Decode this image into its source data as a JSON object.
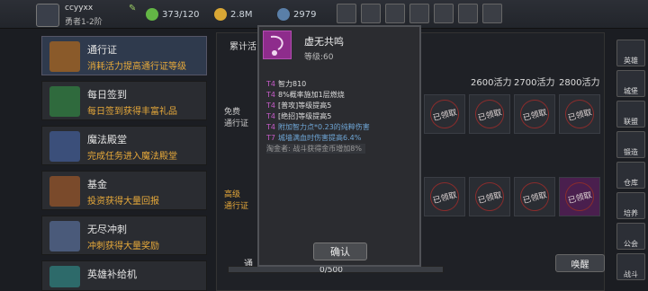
{
  "player": {
    "name": "ccyyxx",
    "rank": "勇者1-2阶"
  },
  "resources": {
    "energy": "373/120",
    "gold": "2.8M",
    "gems": "2979"
  },
  "left_menu": [
    {
      "title": "通行证",
      "subtitle": "消耗活力提高通行证等级"
    },
    {
      "title": "每日签到",
      "subtitle": "每日签到获得丰富礼品"
    },
    {
      "title": "魔法殿堂",
      "subtitle": "完成任务进入魔法殿堂"
    },
    {
      "title": "基金",
      "subtitle": "投资获得大量回报"
    },
    {
      "title": "无尽冲刺",
      "subtitle": "冲刺获得大量奖励"
    },
    {
      "title": "英雄补给机",
      "subtitle": ""
    }
  ],
  "main": {
    "tab_label": "累计活",
    "free_label": "免费\n通行证",
    "premium_label": "高级\n通行证",
    "column_headers": [
      "2600活力",
      "2700活力",
      "2800活力"
    ],
    "claimed_label": "已领取",
    "progress_text": "0/500",
    "progress_fraction": 0,
    "wake_button": "唤醒",
    "bottom_left": "通"
  },
  "popup": {
    "title": "虚无共鸣",
    "level": "等级:60",
    "stats": [
      {
        "tier": "T4",
        "text": "智力810"
      },
      {
        "tier": "T4",
        "text": "8%概率施加1层燃烧"
      },
      {
        "tier": "T4",
        "text": "[普攻]等级提高5"
      },
      {
        "tier": "T4",
        "text": "[绝招]等级提高5"
      },
      {
        "tier": "T4",
        "text": "附加智力点*0.23的纯粹伤害"
      },
      {
        "tier": "T7",
        "text": "城墙满血时伤害提高6.4%"
      },
      {
        "tier": "",
        "text": "淘金者: 战斗获得金币增加8%"
      }
    ],
    "confirm": "确认"
  },
  "right_buttons": [
    "英雄",
    "城堡",
    "联盟",
    "锻造",
    "仓库",
    "培养",
    "公会",
    "战斗"
  ]
}
